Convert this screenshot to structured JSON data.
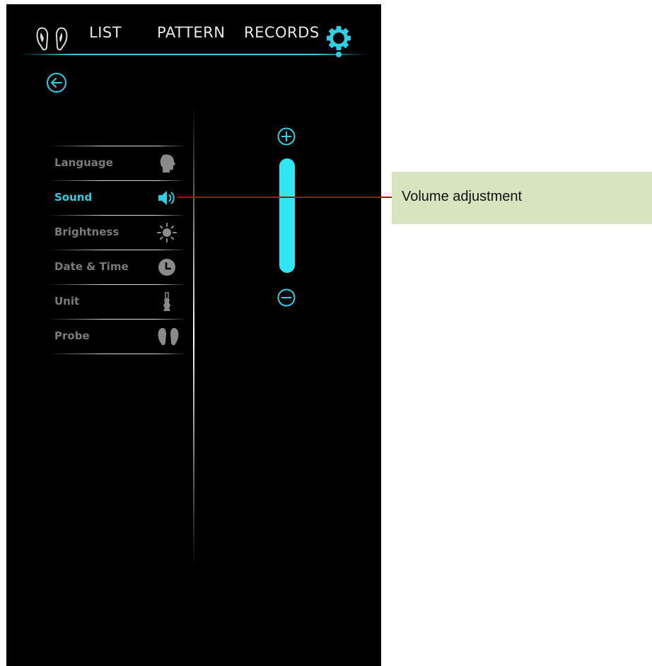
{
  "nav": {
    "tabs": [
      {
        "label": "LIST"
      },
      {
        "label": "PATTERN"
      },
      {
        "label": "RECORDS"
      }
    ],
    "active_tab": "settings",
    "left_icon": "probes-icon",
    "right_icon": "gear-icon"
  },
  "back_icon": "back-arrow-icon",
  "settings_menu": {
    "items": [
      {
        "label": "Language",
        "icon": "head-icon",
        "active": false
      },
      {
        "label": "Sound",
        "icon": "speaker-icon",
        "active": true
      },
      {
        "label": "Brightness",
        "icon": "sun-icon",
        "active": false
      },
      {
        "label": "Date & Time",
        "icon": "clock-icon",
        "active": false
      },
      {
        "label": "Unit",
        "icon": "unit-icon",
        "active": false
      },
      {
        "label": "Probe",
        "icon": "probe-icon",
        "active": false
      }
    ]
  },
  "volume": {
    "level": 1.0,
    "increase_icon": "plus-circle-icon",
    "decrease_icon": "minus-circle-icon"
  },
  "annotation": {
    "text": "Volume adjustment"
  },
  "colors": {
    "accent": "#2fd0e4",
    "inactive_text": "#7a7a7a",
    "inactive_tab": "#e8e8e8",
    "screen_background": "#000000",
    "callout_fill": "#d7e4bd",
    "callout_line": "#c00000"
  }
}
